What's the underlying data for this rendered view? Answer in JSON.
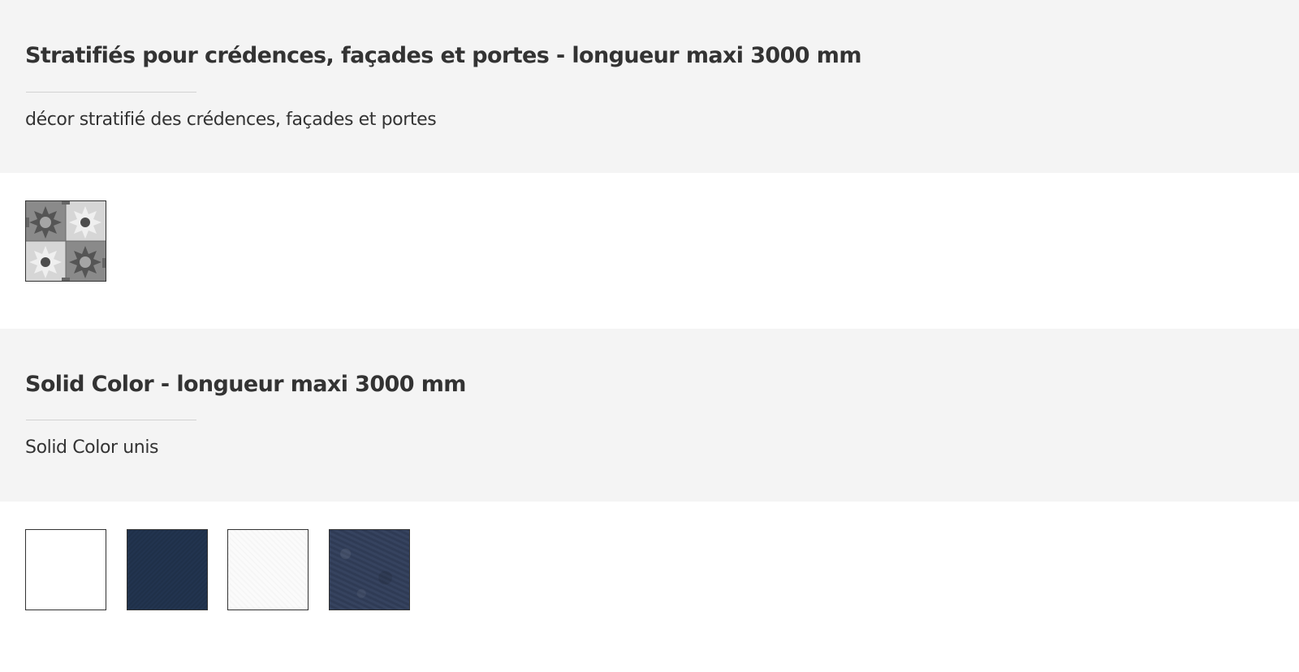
{
  "sections": [
    {
      "title": "Stratifiés pour crédences, façades et portes - longueur maxi 3000 mm",
      "description": "décor stratifié des crédences, façades et portes",
      "swatches": [
        {
          "name": "pattern-tile",
          "colors": [
            "#7a7a7a",
            "#c8c8c8",
            "#4a4a4a",
            "#e0e0e0"
          ]
        }
      ]
    },
    {
      "title": "Solid Color - longueur maxi 3000 mm",
      "description": "Solid Color unis",
      "swatches": [
        {
          "name": "white",
          "color": "#ffffff"
        },
        {
          "name": "navy",
          "color": "#22344f"
        },
        {
          "name": "off-white",
          "color": "#f9f9f9"
        },
        {
          "name": "slate-blue",
          "color": "#36435f"
        }
      ]
    }
  ],
  "colors": {
    "band_gray": "#f4f4f4",
    "text": "#333333",
    "rule": "#d2d2d2"
  }
}
